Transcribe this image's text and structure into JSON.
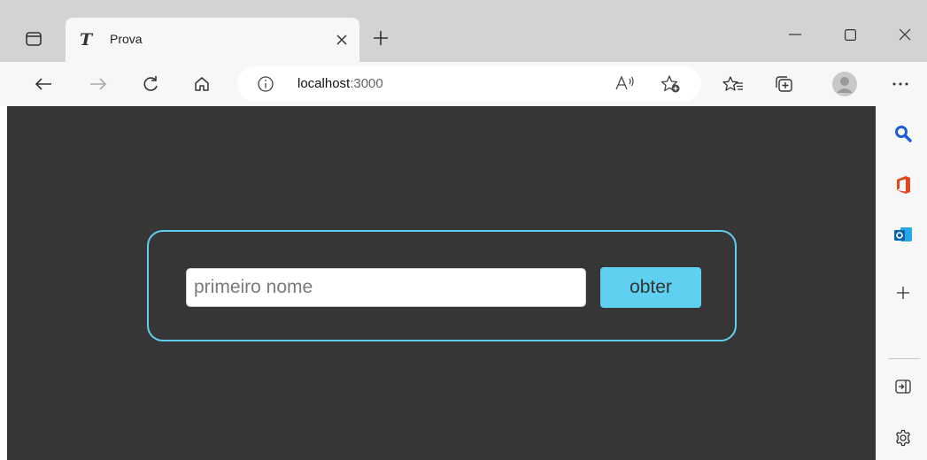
{
  "browser": {
    "tab": {
      "title": "Prova",
      "favicon_text": "T"
    },
    "address_bar": {
      "host": "localhost",
      "port": ":3000"
    },
    "icons": {
      "workspaces": "workspaces-icon",
      "tab_close": "close-icon",
      "new_tab": "plus-icon",
      "minimize": "minimize-icon",
      "maximize": "maximize-icon",
      "close_window": "close-icon",
      "back": "back-arrow-icon",
      "forward": "forward-arrow-icon",
      "refresh": "refresh-icon",
      "home": "home-icon",
      "info": "info-icon",
      "read_aloud": "read-aloud-icon",
      "add_favorite": "add-favorite-icon",
      "favorites": "favorites-icon",
      "collections": "collections-icon",
      "profile": "profile-avatar-icon",
      "more": "more-icon"
    },
    "sidebar": [
      "search-icon",
      "office-icon",
      "outlook-icon",
      "plus-icon",
      "hide-sidebar-icon",
      "settings-icon"
    ]
  },
  "page": {
    "form": {
      "input_placeholder": "primeiro nome",
      "input_value": "",
      "button_label": "obter"
    },
    "colors": {
      "background": "#363636",
      "accent": "#5fd0ef",
      "card_border": "#5fd0ef"
    }
  }
}
